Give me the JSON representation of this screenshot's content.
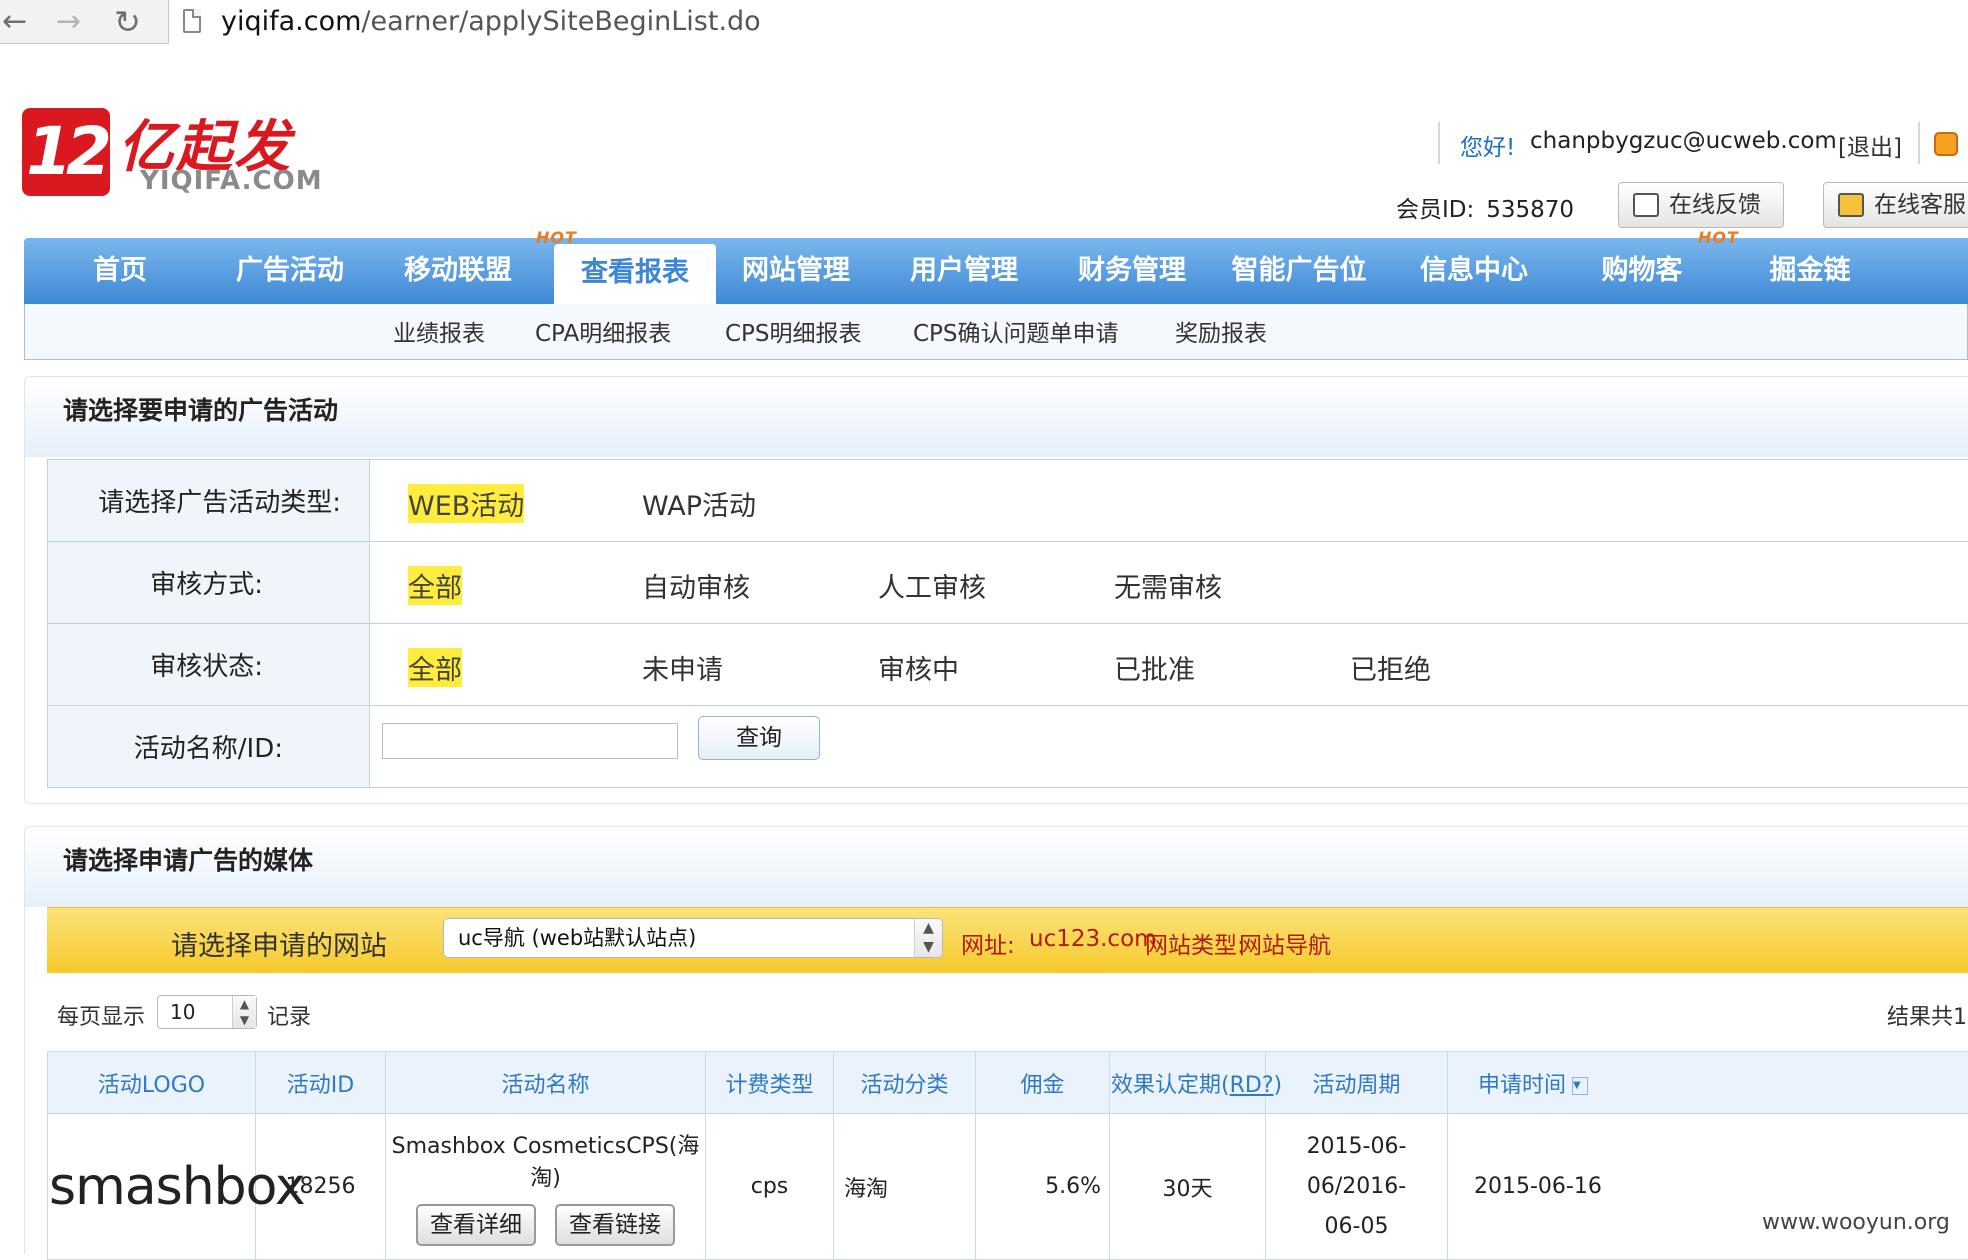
{
  "browser": {
    "back_glyph": "←",
    "forward_glyph": "→",
    "reload_glyph": "↻",
    "url_domain": "yiqifa.com",
    "url_path": "/earner/applySiteBeginList.do"
  },
  "header": {
    "logo_mark": "12",
    "logo_cn": "亿起发",
    "logo_en": "YIQIFA.COM",
    "greeting": "您好!",
    "email": "chanpbygzuc@ucweb.com",
    "logout": "[退出]",
    "member_id_label": "会员ID:",
    "member_id_value": "535870",
    "feedback_button": "在线反馈",
    "service_button": "在线客服"
  },
  "main_nav": {
    "items": [
      "首页",
      "广告活动",
      "移动联盟",
      "查看报表",
      "网站管理",
      "用户管理",
      "财务管理",
      "智能广告位",
      "信息中心",
      "购物客",
      "掘金链"
    ],
    "active": "查看报表",
    "hot_badge": "HOT"
  },
  "sub_nav": {
    "items": [
      "业绩报表",
      "CPA明细报表",
      "CPS明细报表",
      "CPS确认问题单申请",
      "奖励报表"
    ]
  },
  "filter_panel": {
    "title": "请选择要申请的广告活动",
    "rows": [
      {
        "label": "请选择广告活动类型:",
        "options": [
          "WEB活动",
          "WAP活动"
        ],
        "selected": "WEB活动"
      },
      {
        "label": "审核方式:",
        "options": [
          "全部",
          "自动审核",
          "人工审核",
          "无需审核"
        ],
        "selected": "全部"
      },
      {
        "label": "审核状态:",
        "options": [
          "全部",
          "未申请",
          "审核中",
          "已批准",
          "已拒绝"
        ],
        "selected": "全部"
      }
    ],
    "search_label": "活动名称/ID:",
    "search_value": "",
    "query_button": "查询"
  },
  "media_panel": {
    "title": "请选择申请广告的媒体",
    "site_label": "请选择申请的网站",
    "site_selected": "uc导航 (web站默认站点)",
    "url_label": "网址:",
    "url_value": "uc123.com",
    "type_label": "网站类型:",
    "type_value": "网站导航",
    "per_page_label": "每页显示",
    "per_page_value": "10",
    "per_page_unit": "记录",
    "result_total": "结果共1",
    "columns": [
      "活动LOGO",
      "活动ID",
      "活动名称",
      "计费类型",
      "活动分类",
      "佣金",
      "效果认定期",
      "RD?",
      "活动周期",
      "申请时间"
    ],
    "rows": [
      {
        "logo_text": "smashbox",
        "id": "18256",
        "name": "Smashbox CosmeticsCPS(海淘)",
        "detail_button": "查看详细",
        "link_button": "查看链接",
        "billing_type": "cps",
        "category": "海淘",
        "commission": "5.6%",
        "rd_period": "30天",
        "period_start": "2015-06-06/2016-",
        "period_end": "06-05",
        "apply_time": "2015-06-16"
      }
    ]
  },
  "watermark": "www.wooyun.org",
  "colors": {
    "nav_blue": "#3f89d6",
    "highlight_yellow": "#ffec3d",
    "hot_orange": "#f07a18",
    "commission_red": "#e2161f"
  }
}
